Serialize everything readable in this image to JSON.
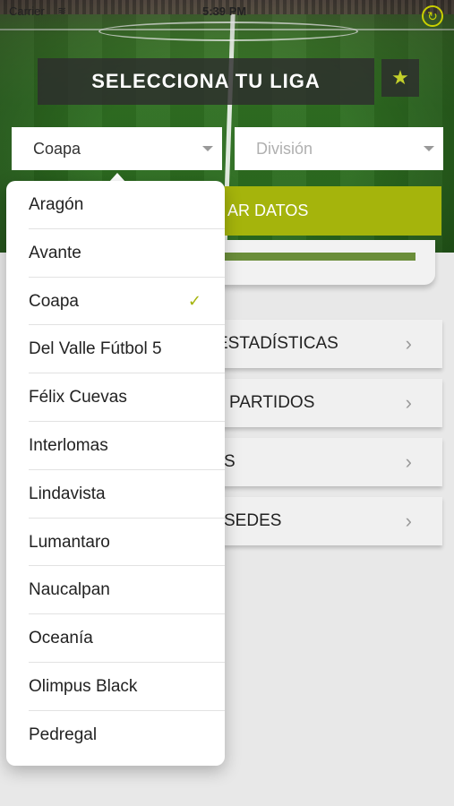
{
  "status_bar": {
    "carrier": "Carrier",
    "wifi": "≋",
    "time": "5:39 PM"
  },
  "header": {
    "title": "SELECCIONA TU LIGA",
    "favorite_icon": "star-icon"
  },
  "selectors": {
    "liga": {
      "value": "Coapa"
    },
    "division": {
      "placeholder": "División"
    }
  },
  "actions": {
    "load_label": "AR DATOS"
  },
  "menu": [
    {
      "label": "ESTADÍSTICAS"
    },
    {
      "label": "PARTIDOS"
    },
    {
      "label": "S"
    },
    {
      "label": "SEDES"
    }
  ],
  "dropdown": {
    "options": [
      {
        "label": "Aragón"
      },
      {
        "label": "Avante"
      },
      {
        "label": "Coapa",
        "selected": true,
        "check": "✓"
      },
      {
        "label": "Del Valle Fútbol 5"
      },
      {
        "label": "Félix Cuevas"
      },
      {
        "label": "Interlomas"
      },
      {
        "label": "Lindavista"
      },
      {
        "label": "Lumantaro"
      },
      {
        "label": "Naucalpan"
      },
      {
        "label": "Oceanía"
      },
      {
        "label": "Olimpus Black"
      },
      {
        "label": "Pedregal"
      }
    ]
  },
  "colors": {
    "accent": "#a5b40c",
    "star": "#c3d12a",
    "refresh": "#c9d000"
  }
}
